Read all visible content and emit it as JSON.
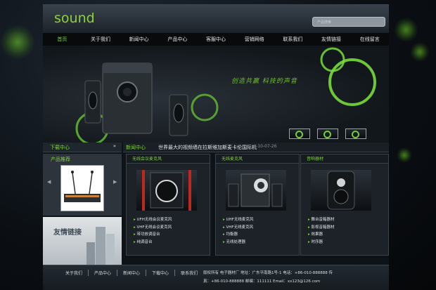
{
  "colors": {
    "accent": "#7fd63b",
    "bg": "#0b0f14",
    "panel": "#1c2228"
  },
  "header": {
    "logo": "sound",
    "search_placeholder": "产品搜索"
  },
  "nav": [
    "首页",
    "关于我们",
    "新闻中心",
    "产品中心",
    "客服中心",
    "营销网络",
    "联系我们",
    "友情链接",
    "在线留言"
  ],
  "banner": {
    "slogan": "创造共赢 科技的声音"
  },
  "sidebar": {
    "title": "下载中心",
    "more": "»"
  },
  "news": {
    "title": "新闻中心",
    "headline": "世界最大的视频墙在拉斯维加斯麦卡伦国际机",
    "date": "--10-07-26"
  },
  "products": {
    "title": "产品推荐",
    "prev": "◀",
    "next": "▶"
  },
  "friends": {
    "title": "友情链接"
  },
  "categories": [
    {
      "title": "无线会议麦克风",
      "items": [
        "UFH无线会议麦克风",
        "VHF无线会议麦克风",
        "带功放调音台",
        "纯调音台"
      ]
    },
    {
      "title": "无线麦克风",
      "items": [
        "UHF无线麦克风",
        "VHF无线麦克风",
        "均衡器",
        "无线处理器"
      ]
    },
    {
      "title": "音响器材",
      "items": [
        "舞台音箱器材",
        "影视音箱器材",
        "效果器",
        "时序器"
      ]
    }
  ],
  "footer": {
    "links": [
      "关于我们",
      "产品中心",
      "新闻中心",
      "下载中心",
      "联系我们"
    ],
    "line1": "版权所有    电子器材厂   地址：广东平南路1号-1   电话：+86-010-888888     传",
    "line2": "真：+86-010-888888    邮编：111111      Email：xx123@126.com"
  }
}
